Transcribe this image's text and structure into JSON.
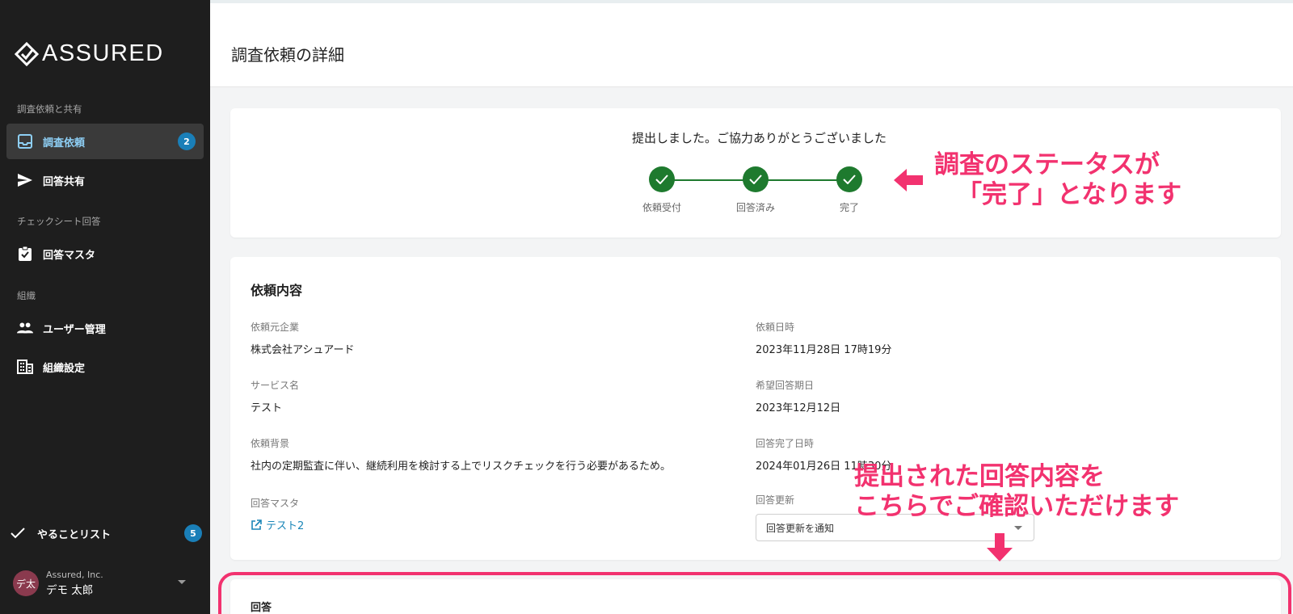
{
  "app": {
    "brand": "ASSURED"
  },
  "sidebar": {
    "section_request": "調査依頼と共有",
    "nav_request_label": "調査依頼",
    "nav_request_badge": "2",
    "nav_share_label": "回答共有",
    "section_checksheet": "チェックシート回答",
    "nav_master_label": "回答マスタ",
    "section_org": "組織",
    "nav_users_label": "ユーザー管理",
    "nav_org_label": "組織設定",
    "todo_label": "やることリスト",
    "todo_badge": "5",
    "user_initials": "デ太",
    "user_org": "Assured, Inc.",
    "user_name": "デモ 太郎"
  },
  "header": {
    "title": "調査依頼の詳細"
  },
  "status": {
    "message": "提出しました。ご協力ありがとうございました",
    "steps": [
      "依頼受付",
      "回答済み",
      "完了"
    ]
  },
  "detail": {
    "title": "依頼内容",
    "requester_label": "依頼元企業",
    "requester_value": "株式会社アシュアード",
    "request_date_label": "依頼日時",
    "request_date_value": "2023年11月28日 17時19分",
    "service_label": "サービス名",
    "service_value": "テスト",
    "deadline_label": "希望回答期日",
    "deadline_value": "2023年12月12日",
    "background_label": "依頼背景",
    "background_value": "社内の定期監査に伴い、継続利用を検討する上でリスクチェックを行う必要があるため。",
    "completed_label": "回答完了日時",
    "completed_value": "2024年01月26日 11時30分",
    "master_label": "回答マスタ",
    "master_link": "テスト2",
    "update_label": "回答更新",
    "update_select_value": "回答更新を通知"
  },
  "answer": {
    "title": "回答"
  },
  "annotations": {
    "status_line1": "調査のステータスが",
    "status_line2": "「完了」となります",
    "answer_line1": "提出された回答内容を",
    "answer_line2": "こちらでご確認いただけます"
  },
  "colors": {
    "accent_pink": "#f2326f",
    "step_green": "#1e7a2e",
    "badge_blue": "#1a7fb8",
    "sidebar_bg": "#1e1e1e"
  }
}
